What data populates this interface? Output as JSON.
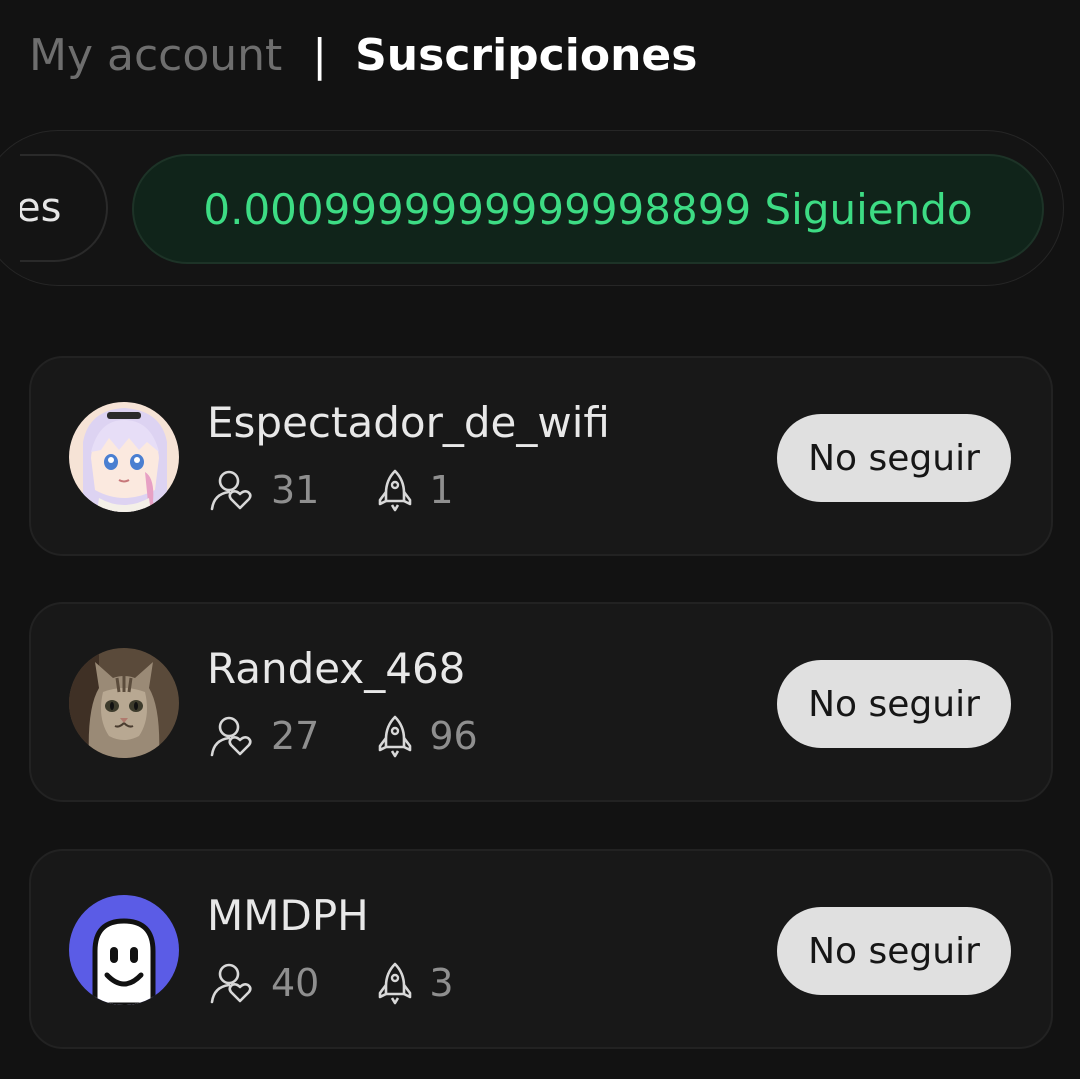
{
  "breadcrumb": {
    "parent": "My account",
    "separator": "|",
    "current": "Suscripciones"
  },
  "tabs": {
    "partial_label": "es",
    "active_label": "0.0009999999999998899 Siguiendo"
  },
  "colors": {
    "background": "#121212",
    "accent_green": "#3ddc84",
    "button_bg": "#e0e0e0"
  },
  "subscriptions": [
    {
      "username": "Espectador_de_wifi",
      "followers": "31",
      "boosts": "1",
      "avatar": "anime-girl-avatar",
      "action_label": "No seguir"
    },
    {
      "username": "Randex_468",
      "followers": "27",
      "boosts": "96",
      "avatar": "cat-avatar",
      "action_label": "No seguir"
    },
    {
      "username": "MMDPH",
      "followers": "40",
      "boosts": "3",
      "avatar": "ghost-avatar",
      "action_label": "No seguir"
    }
  ],
  "icons": {
    "followers": "followers-icon",
    "boosts": "rocket-icon"
  }
}
